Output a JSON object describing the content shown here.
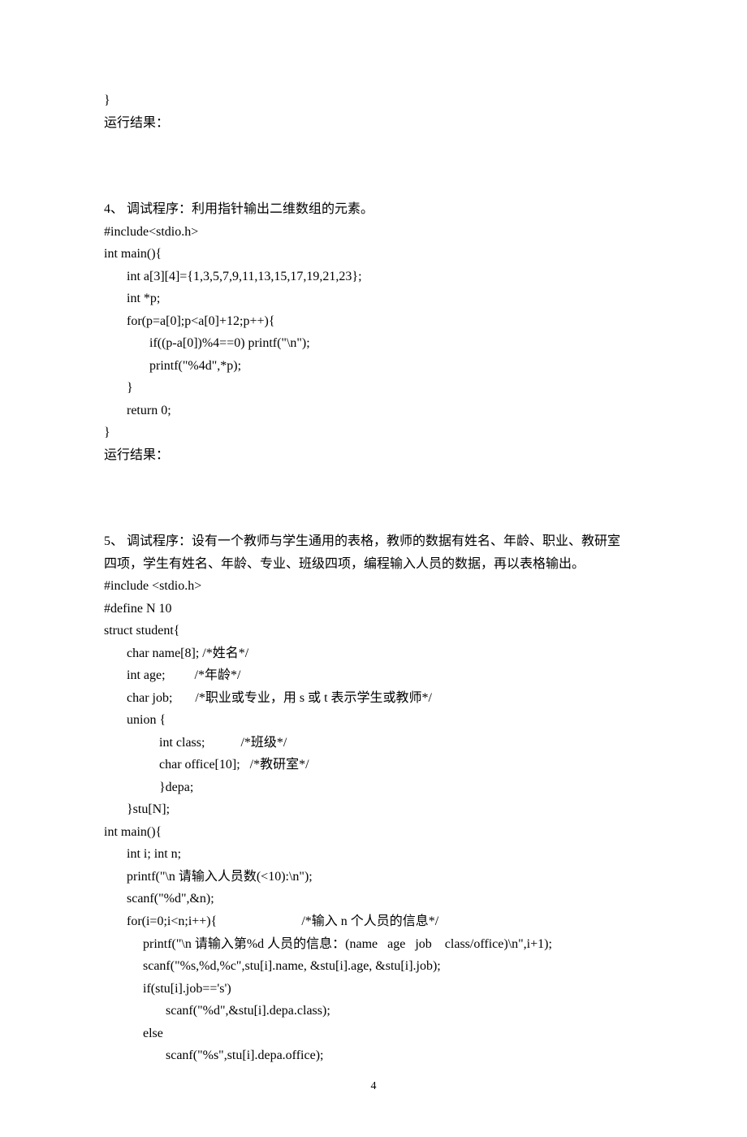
{
  "lines": {
    "l01": "}",
    "l02": "运行结果：",
    "l03": "4、 调试程序：利用指针输出二维数组的元素。",
    "l04": "#include<stdio.h>",
    "l05": "int main(){",
    "l06": "       int a[3][4]={1,3,5,7,9,11,13,15,17,19,21,23};",
    "l07": "       int *p;",
    "l08": "       for(p=a[0];p<a[0]+12;p++){",
    "l09": "              if((p-a[0])%4==0) printf(\"\\n\");",
    "l10": "              printf(\"%4d\",*p);",
    "l11": "       }",
    "l12": "       return 0;",
    "l13": "}",
    "l14": "运行结果：",
    "l15": "5、 调试程序：设有一个教师与学生通用的表格，教师的数据有姓名、年龄、职业、教研室",
    "l16": "四项，学生有姓名、年龄、专业、班级四项，编程输入人员的数据，再以表格输出。",
    "l17": "#include <stdio.h>",
    "l18": "#define N 10",
    "l19": "struct student{",
    "l20": "       char name[8]; /*姓名*/",
    "l21": "       int age;         /*年龄*/",
    "l22": "       char job;       /*职业或专业，用 s 或 t 表示学生或教师*/",
    "l23": "       union {",
    "l24": "                 int class;           /*班级*/",
    "l25": "                 char office[10];   /*教研室*/",
    "l26": "                 }depa;",
    "l27": "       }stu[N];",
    "l28": "int main(){",
    "l29": "       int i; int n;",
    "l30": "       printf(\"\\n 请输入人员数(<10):\\n\");",
    "l31": "       scanf(\"%d\",&n);",
    "l32": "       for(i=0;i<n;i++){                          /*输入 n 个人员的信息*/",
    "l33": "            printf(\"\\n 请输入第%d 人员的信息：(name   age   job    class/office)\\n\",i+1);",
    "l34": "            scanf(\"%s,%d,%c\",stu[i].name, &stu[i].age, &stu[i].job);",
    "l35": "            if(stu[i].job=='s')",
    "l36": "                   scanf(\"%d\",&stu[i].depa.class);",
    "l37": "            else",
    "l38": "                   scanf(\"%s\",stu[i].depa.office);"
  },
  "pageNumber": "4"
}
